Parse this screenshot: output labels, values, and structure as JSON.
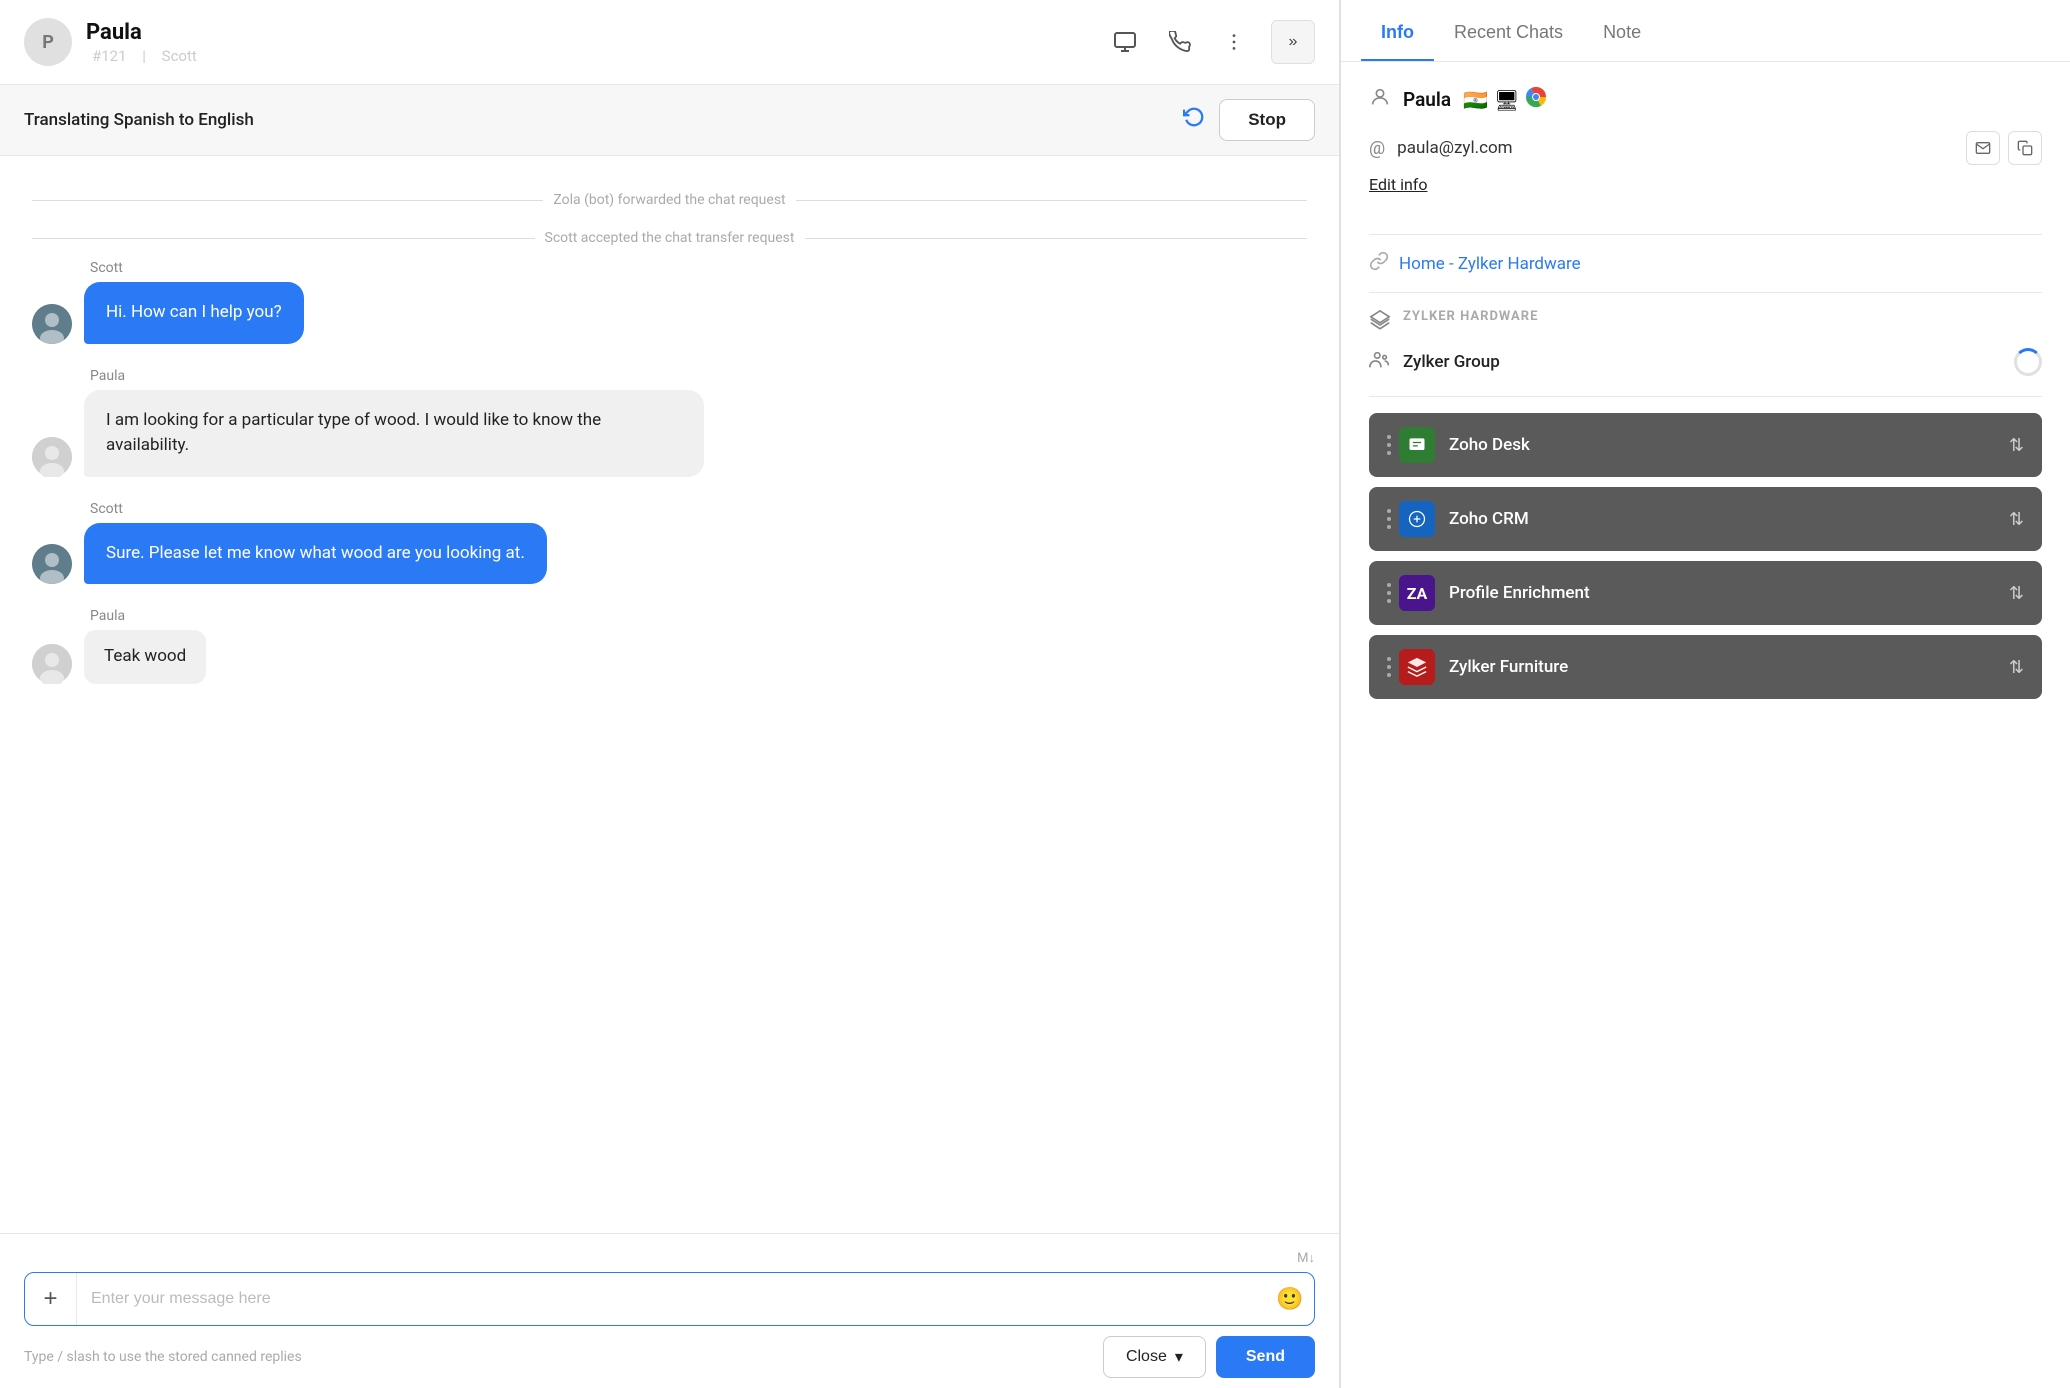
{
  "header": {
    "name": "Paula",
    "ticket_number": "#121",
    "agent": "Scott",
    "separator": "|",
    "expand_label": "»"
  },
  "translation_bar": {
    "text": "Translating Spanish to English",
    "stop_label": "Stop"
  },
  "system_messages": [
    "Zola (bot) forwarded the chat request",
    "Scott accepted the chat transfer request"
  ],
  "messages": [
    {
      "id": "m1",
      "sender": "Scott",
      "type": "agent",
      "text": "Hi. How can I help you?"
    },
    {
      "id": "m2",
      "sender": "Paula",
      "type": "visitor",
      "text": "I am looking for a particular type of wood. I would like to know the availability."
    },
    {
      "id": "m3",
      "sender": "Scott",
      "type": "agent",
      "text": "Sure. Please let me know what wood are you looking at."
    },
    {
      "id": "m4",
      "sender": "Paula",
      "type": "visitor",
      "text": "Teak wood"
    }
  ],
  "input": {
    "placeholder": "Enter your message here",
    "hint": "Type / slash to use the stored canned replies",
    "close_label": "Close",
    "send_label": "Send",
    "markdown_indicator": "M↓"
  },
  "info_panel": {
    "tabs": [
      "Info",
      "Recent Chats",
      "Note"
    ],
    "active_tab": "Info",
    "contact": {
      "name": "Paula",
      "flags": [
        "🇮🇳",
        "🖥",
        "🌐"
      ],
      "email": "paula@zyl.com"
    },
    "edit_info_label": "Edit info",
    "link": "Home - Zylker Hardware",
    "company_label": "ZYLKER HARDWARE",
    "group_name": "Zylker Group",
    "integrations": [
      {
        "name": "Zoho Desk",
        "icon_color": "#2e7d32",
        "icon_char": "🗂"
      },
      {
        "name": "Zoho CRM",
        "icon_color": "#1565c0",
        "icon_char": "🔗"
      },
      {
        "name": "Profile Enrichment",
        "icon_color": "#4a148c",
        "icon_char": "🅰"
      },
      {
        "name": "Zylker Furniture",
        "icon_color": "#b71c1c",
        "icon_char": "⚙"
      }
    ]
  }
}
